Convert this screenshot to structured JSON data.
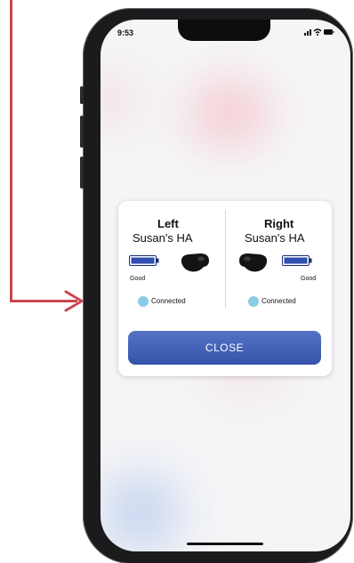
{
  "status_bar": {
    "time": "9:53"
  },
  "dialog": {
    "left": {
      "title": "Left",
      "name": "Susan's HA",
      "battery_status": "Good",
      "connection": "Connected"
    },
    "right": {
      "title": "Right",
      "name": "Susan's HA",
      "battery_status": "Good",
      "connection": "Connected"
    },
    "close_label": "CLOSE"
  },
  "colors": {
    "arrow": "#c9484f",
    "button": "#3d5cb5",
    "battery": "#2f4fb0",
    "connected_dot": "#8ccbe8"
  },
  "icons": [
    "arrow-icon",
    "battery-icon",
    "hearing-aid-icon",
    "signal-icon",
    "wifi-icon"
  ]
}
